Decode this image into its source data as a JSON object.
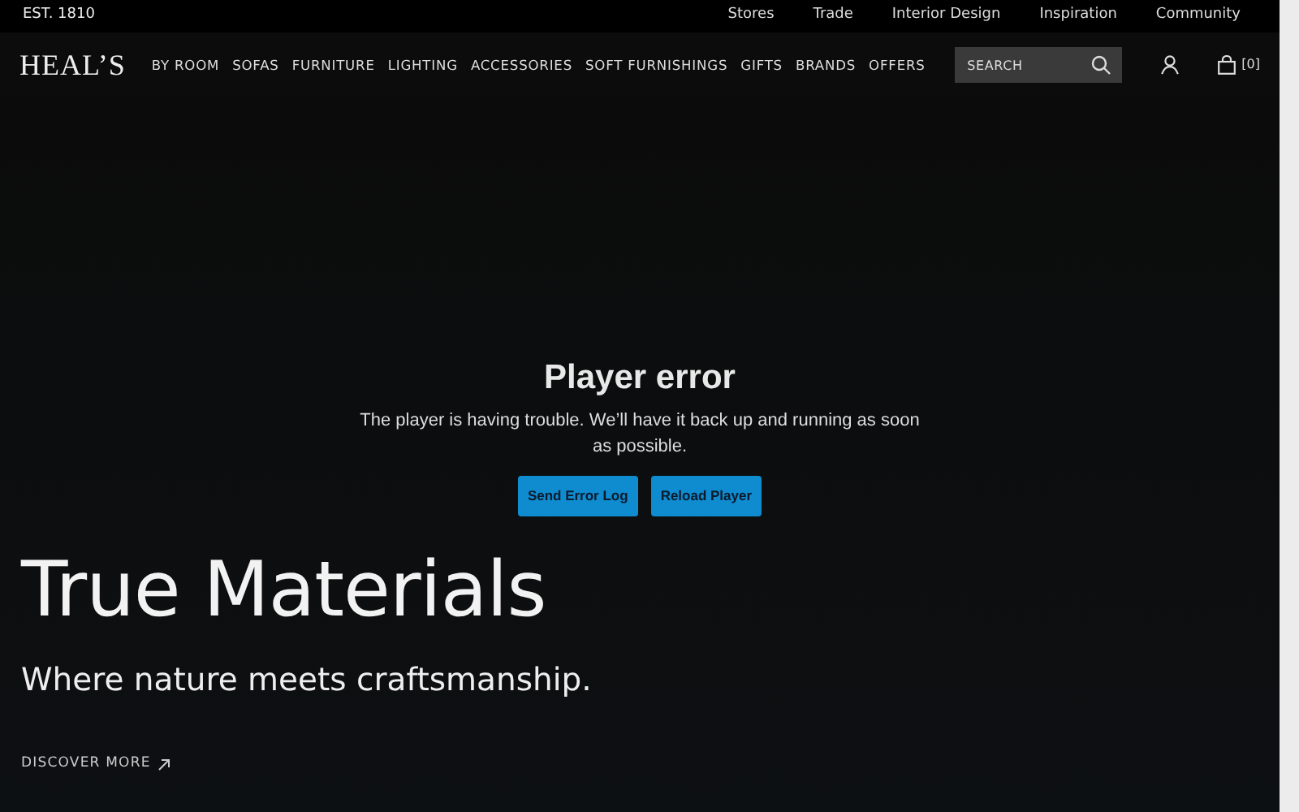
{
  "top_bar": {
    "tagline": "EST. 1810",
    "links": [
      "Stores",
      "Trade",
      "Interior Design",
      "Inspiration",
      "Community"
    ]
  },
  "header": {
    "logo": "HEAL’S",
    "nav": [
      "BY ROOM",
      "SOFAS",
      "FURNITURE",
      "LIGHTING",
      "ACCESSORIES",
      "SOFT FURNISHINGS",
      "GIFTS",
      "BRANDS",
      "OFFERS"
    ],
    "search": {
      "placeholder": "SEARCH"
    },
    "basket_count": "[0]"
  },
  "player_error": {
    "title": "Player error",
    "message": "The player is having trouble. We’ll have it back up and running as soon as possible.",
    "buttons": [
      "Send Error Log",
      "Reload Player"
    ]
  },
  "hero": {
    "title": "True Materials",
    "subtitle": "Where nature meets craftsmanship.",
    "link": "DISCOVER MORE"
  }
}
